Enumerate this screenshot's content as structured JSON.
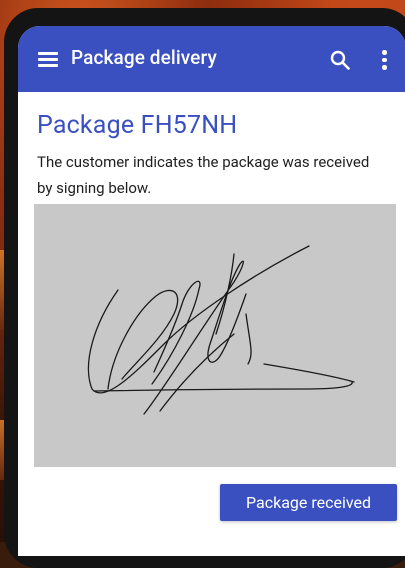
{
  "app_bar": {
    "title": "Package delivery",
    "icons": {
      "menu": "menu-icon",
      "search": "search-icon",
      "more": "more-vert-icon"
    },
    "color": "#3a4fc0"
  },
  "package": {
    "title": "Package FH57NH",
    "description": "The customer indicates the package was received by signing below."
  },
  "signature_pad": {
    "background": "#c8c8c8",
    "has_signature": true
  },
  "actions": {
    "confirm_label": "Package received"
  },
  "colors": {
    "primary": "#3a4fc0",
    "text": "#1f1f1f",
    "surface": "#ffffff"
  }
}
